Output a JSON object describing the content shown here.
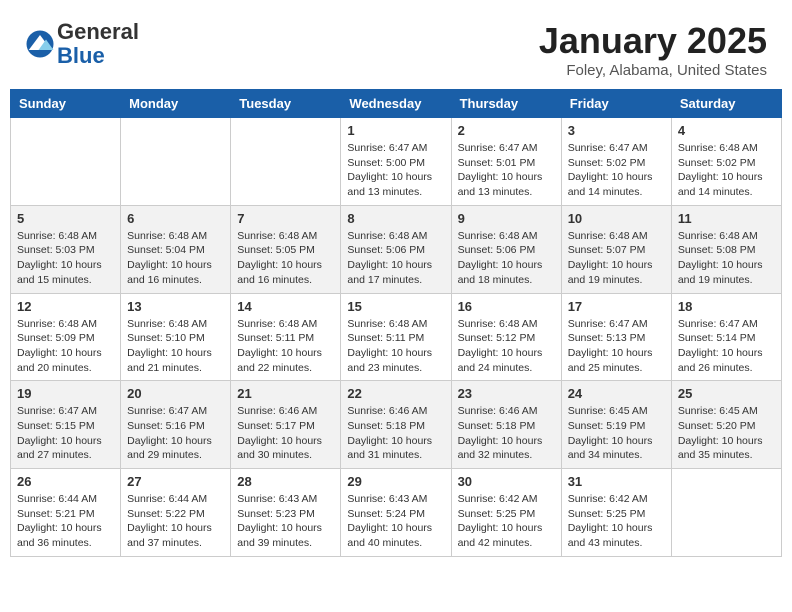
{
  "header": {
    "logo_general": "General",
    "logo_blue": "Blue",
    "month_title": "January 2025",
    "location": "Foley, Alabama, United States"
  },
  "days_of_week": [
    "Sunday",
    "Monday",
    "Tuesday",
    "Wednesday",
    "Thursday",
    "Friday",
    "Saturday"
  ],
  "weeks": [
    [
      {
        "day": "",
        "info": ""
      },
      {
        "day": "",
        "info": ""
      },
      {
        "day": "",
        "info": ""
      },
      {
        "day": "1",
        "info": "Sunrise: 6:47 AM\nSunset: 5:00 PM\nDaylight: 10 hours\nand 13 minutes."
      },
      {
        "day": "2",
        "info": "Sunrise: 6:47 AM\nSunset: 5:01 PM\nDaylight: 10 hours\nand 13 minutes."
      },
      {
        "day": "3",
        "info": "Sunrise: 6:47 AM\nSunset: 5:02 PM\nDaylight: 10 hours\nand 14 minutes."
      },
      {
        "day": "4",
        "info": "Sunrise: 6:48 AM\nSunset: 5:02 PM\nDaylight: 10 hours\nand 14 minutes."
      }
    ],
    [
      {
        "day": "5",
        "info": "Sunrise: 6:48 AM\nSunset: 5:03 PM\nDaylight: 10 hours\nand 15 minutes."
      },
      {
        "day": "6",
        "info": "Sunrise: 6:48 AM\nSunset: 5:04 PM\nDaylight: 10 hours\nand 16 minutes."
      },
      {
        "day": "7",
        "info": "Sunrise: 6:48 AM\nSunset: 5:05 PM\nDaylight: 10 hours\nand 16 minutes."
      },
      {
        "day": "8",
        "info": "Sunrise: 6:48 AM\nSunset: 5:06 PM\nDaylight: 10 hours\nand 17 minutes."
      },
      {
        "day": "9",
        "info": "Sunrise: 6:48 AM\nSunset: 5:06 PM\nDaylight: 10 hours\nand 18 minutes."
      },
      {
        "day": "10",
        "info": "Sunrise: 6:48 AM\nSunset: 5:07 PM\nDaylight: 10 hours\nand 19 minutes."
      },
      {
        "day": "11",
        "info": "Sunrise: 6:48 AM\nSunset: 5:08 PM\nDaylight: 10 hours\nand 19 minutes."
      }
    ],
    [
      {
        "day": "12",
        "info": "Sunrise: 6:48 AM\nSunset: 5:09 PM\nDaylight: 10 hours\nand 20 minutes."
      },
      {
        "day": "13",
        "info": "Sunrise: 6:48 AM\nSunset: 5:10 PM\nDaylight: 10 hours\nand 21 minutes."
      },
      {
        "day": "14",
        "info": "Sunrise: 6:48 AM\nSunset: 5:11 PM\nDaylight: 10 hours\nand 22 minutes."
      },
      {
        "day": "15",
        "info": "Sunrise: 6:48 AM\nSunset: 5:11 PM\nDaylight: 10 hours\nand 23 minutes."
      },
      {
        "day": "16",
        "info": "Sunrise: 6:48 AM\nSunset: 5:12 PM\nDaylight: 10 hours\nand 24 minutes."
      },
      {
        "day": "17",
        "info": "Sunrise: 6:47 AM\nSunset: 5:13 PM\nDaylight: 10 hours\nand 25 minutes."
      },
      {
        "day": "18",
        "info": "Sunrise: 6:47 AM\nSunset: 5:14 PM\nDaylight: 10 hours\nand 26 minutes."
      }
    ],
    [
      {
        "day": "19",
        "info": "Sunrise: 6:47 AM\nSunset: 5:15 PM\nDaylight: 10 hours\nand 27 minutes."
      },
      {
        "day": "20",
        "info": "Sunrise: 6:47 AM\nSunset: 5:16 PM\nDaylight: 10 hours\nand 29 minutes."
      },
      {
        "day": "21",
        "info": "Sunrise: 6:46 AM\nSunset: 5:17 PM\nDaylight: 10 hours\nand 30 minutes."
      },
      {
        "day": "22",
        "info": "Sunrise: 6:46 AM\nSunset: 5:18 PM\nDaylight: 10 hours\nand 31 minutes."
      },
      {
        "day": "23",
        "info": "Sunrise: 6:46 AM\nSunset: 5:18 PM\nDaylight: 10 hours\nand 32 minutes."
      },
      {
        "day": "24",
        "info": "Sunrise: 6:45 AM\nSunset: 5:19 PM\nDaylight: 10 hours\nand 34 minutes."
      },
      {
        "day": "25",
        "info": "Sunrise: 6:45 AM\nSunset: 5:20 PM\nDaylight: 10 hours\nand 35 minutes."
      }
    ],
    [
      {
        "day": "26",
        "info": "Sunrise: 6:44 AM\nSunset: 5:21 PM\nDaylight: 10 hours\nand 36 minutes."
      },
      {
        "day": "27",
        "info": "Sunrise: 6:44 AM\nSunset: 5:22 PM\nDaylight: 10 hours\nand 37 minutes."
      },
      {
        "day": "28",
        "info": "Sunrise: 6:43 AM\nSunset: 5:23 PM\nDaylight: 10 hours\nand 39 minutes."
      },
      {
        "day": "29",
        "info": "Sunrise: 6:43 AM\nSunset: 5:24 PM\nDaylight: 10 hours\nand 40 minutes."
      },
      {
        "day": "30",
        "info": "Sunrise: 6:42 AM\nSunset: 5:25 PM\nDaylight: 10 hours\nand 42 minutes."
      },
      {
        "day": "31",
        "info": "Sunrise: 6:42 AM\nSunset: 5:25 PM\nDaylight: 10 hours\nand 43 minutes."
      },
      {
        "day": "",
        "info": ""
      }
    ]
  ]
}
